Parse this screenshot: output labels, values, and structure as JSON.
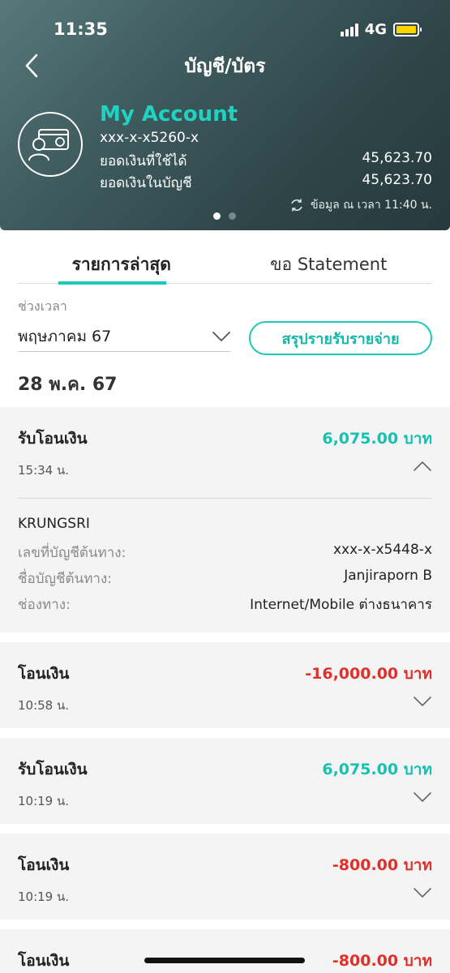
{
  "status": {
    "time": "11:35",
    "network": "4G"
  },
  "nav": {
    "title": "บัญชี/บัตร"
  },
  "account": {
    "name": "My Account",
    "number": "xxx-x-x5260-x",
    "available_label": "ยอดเงินที่ใช้ได้",
    "available_value": "45,623.70",
    "balance_label": "ยอดเงินในบัญชี",
    "balance_value": "45,623.70",
    "updated_text": "ข้อมูล ณ เวลา 11:40 น."
  },
  "tabs": [
    {
      "label": "รายการล่าสุด",
      "active": true
    },
    {
      "label": "ขอ Statement",
      "active": false
    }
  ],
  "filter": {
    "period_label": "ช่วงเวลา",
    "period_value": "พฤษภาคม 67",
    "summary_button": "สรุปรายรับรายจ่าย"
  },
  "date_heading": "28 พ.ค. 67",
  "transactions": [
    {
      "title": "รับโอนเงิน",
      "amount": "6,075.00 บาท",
      "time": "15:34 น.",
      "expanded": true,
      "details": {
        "bank": "KRUNGSRI",
        "rows": [
          {
            "key": "เลขที่บัญชีต้นทาง:",
            "value": "xxx-x-x5448-x"
          },
          {
            "key": "ชื่อบัญชีต้นทาง:",
            "value": "Janjiraporn B"
          },
          {
            "key": "ช่องทาง:",
            "value": "Internet/Mobile ต่างธนาคาร"
          }
        ]
      }
    },
    {
      "title": "โอนเงิน",
      "amount": "-16,000.00 บาท",
      "time": "10:58 น.",
      "expanded": false
    },
    {
      "title": "รับโอนเงิน",
      "amount": "6,075.00 บาท",
      "time": "10:19 น.",
      "expanded": false
    },
    {
      "title": "โอนเงิน",
      "amount": "-800.00 บาท",
      "time": "10:19 น.",
      "expanded": false
    },
    {
      "title": "โอนเงิน",
      "amount": "-800.00 บาท",
      "time": "",
      "expanded": false
    }
  ],
  "colors": {
    "accent": "#1cc8b8",
    "positive": "#17c1b1",
    "negative": "#e0302c",
    "battery": "#ffd400"
  }
}
